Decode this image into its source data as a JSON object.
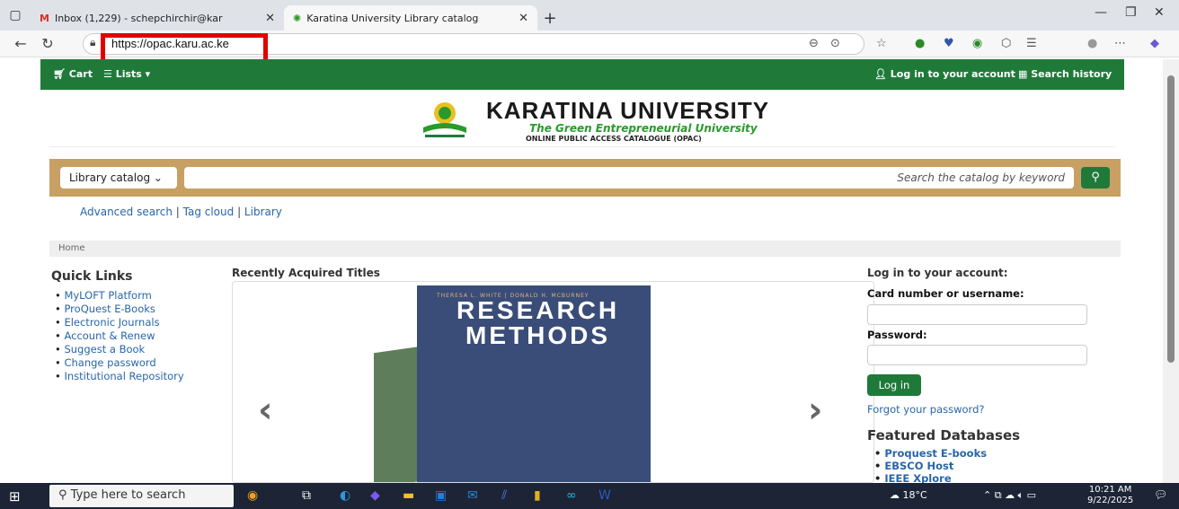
{
  "browser": {
    "tabs": [
      {
        "title": "Inbox (1,229) - schepchirchir@kar"
      },
      {
        "title": "Karatina University Library catalog"
      }
    ],
    "url": "https://opac.karu.ac.ke"
  },
  "topnav": {
    "cart": "Cart",
    "lists": "Lists ▾",
    "login": "Log in to your account",
    "history": "Search history"
  },
  "header": {
    "university": "KARATINA UNIVERSITY",
    "motto": "The Green Entrepreneurial University",
    "subtitle": "ONLINE PUBLIC ACCESS CATALOGUE (OPAC)"
  },
  "search": {
    "scope": "Library catalog",
    "placeholder": "Search the catalog by keyword"
  },
  "sublinks": {
    "advanced": "Advanced search",
    "tagcloud": "Tag cloud",
    "library": "Library"
  },
  "breadcrumb": "Home",
  "quicklinks": {
    "heading": "Quick Links",
    "items": [
      "MyLOFT Platform",
      "ProQuest E-Books",
      "Electronic Journals",
      "Account & Renew",
      "Suggest a Book",
      "Change password",
      "Institutional Repository"
    ]
  },
  "recent": {
    "heading": "Recently Acquired Titles",
    "book_authors": "THERESA L. WHITE | DONALD H. MCBURNEY",
    "book_title_1": "RESEARCH",
    "book_title_2": "METHODS"
  },
  "login": {
    "heading": "Log in to your account:",
    "card_label": "Card number or username:",
    "password_label": "Password:",
    "button": "Log in",
    "forgot": "Forgot your password?"
  },
  "databases": {
    "heading": "Featured Databases",
    "items": [
      "Proquest E-books",
      "EBSCO Host",
      "IEEE Xplore"
    ]
  },
  "taskbar": {
    "search": "Type here to search",
    "temperature": "18°C",
    "time": "10:21 AM",
    "date": "9/22/2025"
  }
}
